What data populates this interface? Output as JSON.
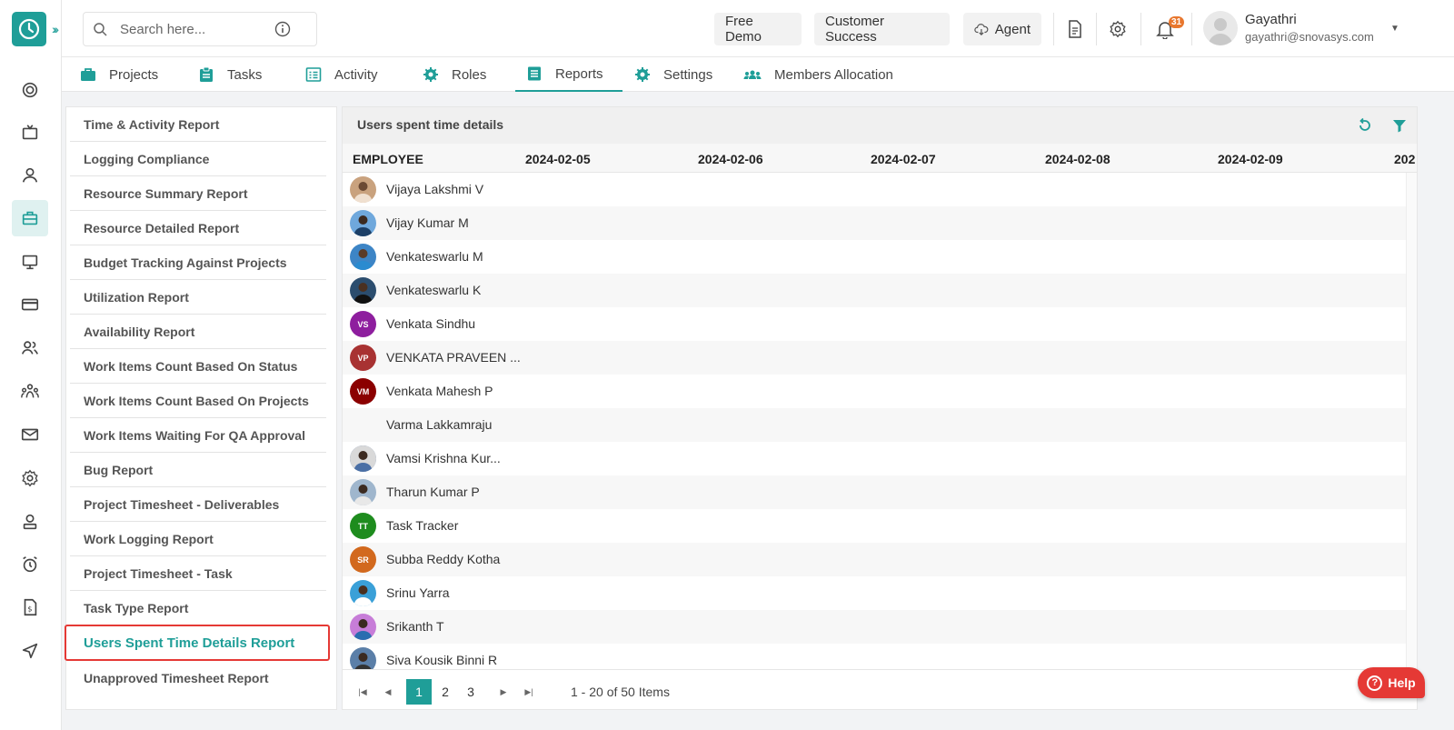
{
  "search": {
    "placeholder": "Search here..."
  },
  "header": {
    "free_demo": "Free Demo",
    "customer_success": "Customer Success",
    "agent": "Agent",
    "notification_count": "31",
    "user_name": "Gayathri",
    "user_email": "gayathri@snovasys.com"
  },
  "tabs": [
    {
      "label": "Projects",
      "icon": "briefcase-icon"
    },
    {
      "label": "Tasks",
      "icon": "clipboard-icon"
    },
    {
      "label": "Activity",
      "icon": "list-icon"
    },
    {
      "label": "Roles",
      "icon": "roles-gear-icon"
    },
    {
      "label": "Reports",
      "icon": "report-icon"
    },
    {
      "label": "Settings",
      "icon": "gear-icon"
    },
    {
      "label": "Members Allocation",
      "icon": "group-icon"
    }
  ],
  "reports_menu": [
    "Time & Activity Report",
    "Logging Compliance",
    "Resource Summary Report",
    "Resource Detailed Report",
    "Budget Tracking Against Projects",
    "Utilization Report",
    "Availability Report",
    "Work Items Count Based On Status",
    "Work Items Count Based On Projects",
    "Work Items Waiting For QA Approval",
    "Bug Report",
    "Project Timesheet - Deliverables",
    "Work Logging Report",
    "Project Timesheet - Task",
    "Task Type Report",
    "Users Spent Time Details Report",
    "Unapproved Timesheet Report"
  ],
  "panel": {
    "title": "Users spent time details",
    "columns": [
      "EMPLOYEE",
      "2024-02-05",
      "2024-02-06",
      "2024-02-07",
      "2024-02-08",
      "2024-02-09",
      "202"
    ]
  },
  "employees": [
    {
      "name": "Vijaya Lakshmi V",
      "initials": "",
      "color": "#c9a27e"
    },
    {
      "name": "Vijay Kumar M",
      "initials": "",
      "color": "#6fa8dc"
    },
    {
      "name": "Venkateswarlu M",
      "initials": "",
      "color": "#3d85c6"
    },
    {
      "name": "Venkateswarlu K",
      "initials": "",
      "color": "#2b4d6e"
    },
    {
      "name": "Venkata Sindhu",
      "initials": "VS",
      "color": "#8e1e9e"
    },
    {
      "name": "VENKATA PRAVEEN ...",
      "initials": "VP",
      "color": "#a83232"
    },
    {
      "name": "Venkata Mahesh P",
      "initials": "VM",
      "color": "#8b0000"
    },
    {
      "name": "Varma Lakkamraju",
      "initials": "",
      "color": ""
    },
    {
      "name": "Vamsi Krishna Kur...",
      "initials": "",
      "color": "#4a6fa5"
    },
    {
      "name": "Tharun Kumar P",
      "initials": "",
      "color": "#9fb6cd"
    },
    {
      "name": "Task Tracker",
      "initials": "TT",
      "color": "#1e8c1e"
    },
    {
      "name": "Subba Reddy Kotha",
      "initials": "SR",
      "color": "#d2691e"
    },
    {
      "name": "Srinu Yarra",
      "initials": "",
      "color": "#3aa0d8"
    },
    {
      "name": "Srikanth T",
      "initials": "",
      "color": "#c77dd8"
    },
    {
      "name": "Siva Kousik Binni R",
      "initials": "",
      "color": "#5b7fa8"
    }
  ],
  "pager": {
    "pages": [
      "1",
      "2",
      "3"
    ],
    "active_page": "1",
    "info": "1 - 20 of 50 Items"
  },
  "help": {
    "label": "Help"
  },
  "colors": {
    "accent": "#1f9e98",
    "highlight": "#e53935"
  }
}
